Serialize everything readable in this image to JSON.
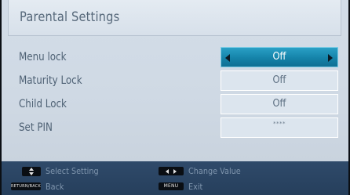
{
  "title": "Parental Settings",
  "settings": [
    {
      "label": "Menu lock",
      "value": "Off"
    },
    {
      "label": "Maturity Lock",
      "value": "Off"
    },
    {
      "label": "Child Lock",
      "value": "Off"
    },
    {
      "label": "Set PIN",
      "value": "****"
    }
  ],
  "footer": {
    "select_setting": "Select Setting",
    "change_value": "Change Value",
    "back_key": "RETURN/BACK",
    "back": "Back",
    "menu_key": "MENU",
    "exit": "Exit"
  },
  "colors": {
    "selected": "#1583a9",
    "panel": "#d3dde8",
    "footer": "#2f4a6a",
    "label": "#4f6275"
  }
}
